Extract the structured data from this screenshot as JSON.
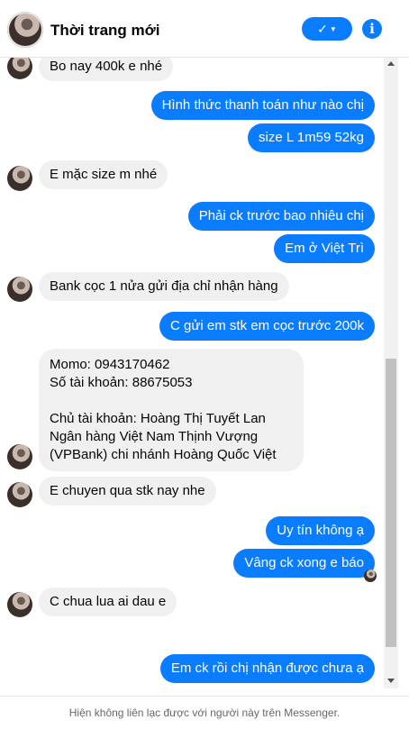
{
  "header": {
    "title": "Thời trang mới",
    "status_icon": "check-icon",
    "info_icon": "info-icon"
  },
  "colors": {
    "accent": "#0a7cff",
    "incoming_bubble": "#f0f0f0"
  },
  "messages": [
    {
      "dir": "in",
      "text": "Bo nay 400k e nhé"
    },
    {
      "dir": "out",
      "text": "Hình thức thanh toán như nào chị"
    },
    {
      "dir": "out",
      "text": "size L 1m59 52kg"
    },
    {
      "dir": "in",
      "text": "E mặc size m nhé"
    },
    {
      "dir": "out",
      "text": "Phải ck trước bao nhiêu chị"
    },
    {
      "dir": "out",
      "text": "Em ở Việt Trì"
    },
    {
      "dir": "in",
      "text": "Bank cọc 1 nửa gửi địa chỉ nhận hàng"
    },
    {
      "dir": "out",
      "text": "C gửi em stk em cọc trước 200k"
    },
    {
      "dir": "in",
      "lines": [
        "Momo: 0943170462",
        "Số tài khoản: 88675053",
        "",
        "Chủ tài khoản: Hoàng Thị Tuyết Lan",
        "Ngân hàng Việt Nam Thịnh Vượng",
        "(VPBank) chi nhánh Hoàng Quốc Việt"
      ]
    },
    {
      "dir": "in",
      "text": "E chuyen qua stk nay nhe"
    },
    {
      "dir": "out",
      "text": "Uy tín không ạ"
    },
    {
      "dir": "out",
      "text": "Vâng ck xong e báo"
    },
    {
      "dir": "in",
      "text": "C chua lua ai dau e"
    },
    {
      "dir": "out",
      "text": "Em ck rồi chị nhận được chưa ạ"
    }
  ],
  "footer": {
    "notice": "Hiện không liên lạc được với người này trên Messenger."
  }
}
